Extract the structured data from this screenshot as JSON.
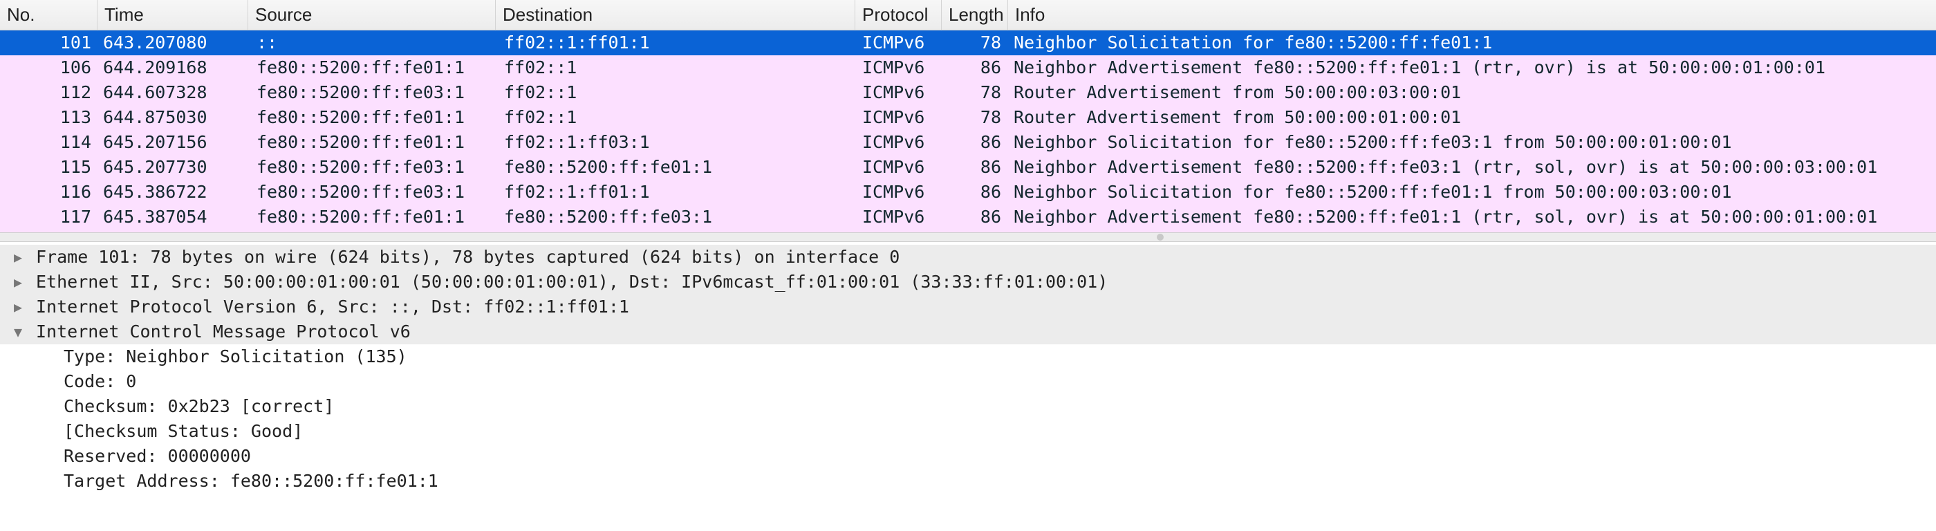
{
  "columns": [
    {
      "key": "no",
      "label": "No."
    },
    {
      "key": "time",
      "label": "Time"
    },
    {
      "key": "source",
      "label": "Source"
    },
    {
      "key": "destination",
      "label": "Destination"
    },
    {
      "key": "protocol",
      "label": "Protocol"
    },
    {
      "key": "length",
      "label": "Length"
    },
    {
      "key": "info",
      "label": "Info"
    }
  ],
  "packets": [
    {
      "no": "101",
      "time": "643.207080",
      "source": "::",
      "destination": "ff02::1:ff01:1",
      "protocol": "ICMPv6",
      "length": "78",
      "info": "Neighbor Solicitation for fe80::5200:ff:fe01:1"
    },
    {
      "no": "106",
      "time": "644.209168",
      "source": "fe80::5200:ff:fe01:1",
      "destination": "ff02::1",
      "protocol": "ICMPv6",
      "length": "86",
      "info": "Neighbor Advertisement fe80::5200:ff:fe01:1 (rtr, ovr) is at 50:00:00:01:00:01"
    },
    {
      "no": "112",
      "time": "644.607328",
      "source": "fe80::5200:ff:fe03:1",
      "destination": "ff02::1",
      "protocol": "ICMPv6",
      "length": "78",
      "info": "Router Advertisement from 50:00:00:03:00:01"
    },
    {
      "no": "113",
      "time": "644.875030",
      "source": "fe80::5200:ff:fe01:1",
      "destination": "ff02::1",
      "protocol": "ICMPv6",
      "length": "78",
      "info": "Router Advertisement from 50:00:00:01:00:01"
    },
    {
      "no": "114",
      "time": "645.207156",
      "source": "fe80::5200:ff:fe01:1",
      "destination": "ff02::1:ff03:1",
      "protocol": "ICMPv6",
      "length": "86",
      "info": "Neighbor Solicitation for fe80::5200:ff:fe03:1 from 50:00:00:01:00:01"
    },
    {
      "no": "115",
      "time": "645.207730",
      "source": "fe80::5200:ff:fe03:1",
      "destination": "fe80::5200:ff:fe01:1",
      "protocol": "ICMPv6",
      "length": "86",
      "info": "Neighbor Advertisement fe80::5200:ff:fe03:1 (rtr, sol, ovr) is at 50:00:00:03:00:01"
    },
    {
      "no": "116",
      "time": "645.386722",
      "source": "fe80::5200:ff:fe03:1",
      "destination": "ff02::1:ff01:1",
      "protocol": "ICMPv6",
      "length": "86",
      "info": "Neighbor Solicitation for fe80::5200:ff:fe01:1 from 50:00:00:03:00:01"
    },
    {
      "no": "117",
      "time": "645.387054",
      "source": "fe80::5200:ff:fe01:1",
      "destination": "fe80::5200:ff:fe03:1",
      "protocol": "ICMPv6",
      "length": "86",
      "info": "Neighbor Advertisement fe80::5200:ff:fe01:1 (rtr, sol, ovr) is at 50:00:00:01:00:01"
    }
  ],
  "selected_packet": "101",
  "details": {
    "frame": "Frame 101: 78 bytes on wire (624 bits), 78 bytes captured (624 bits) on interface 0",
    "ethernet": "Ethernet II, Src: 50:00:00:01:00:01 (50:00:00:01:00:01), Dst: IPv6mcast_ff:01:00:01 (33:33:ff:01:00:01)",
    "ipv6": "Internet Protocol Version 6, Src: ::, Dst: ff02::1:ff01:1",
    "icmpv6": "Internet Control Message Protocol v6",
    "icmpv6_fields": [
      "Type: Neighbor Solicitation (135)",
      "Code: 0",
      "Checksum: 0x2b23 [correct]",
      "[Checksum Status: Good]",
      "Reserved: 00000000",
      "Target Address: fe80::5200:ff:fe01:1"
    ]
  },
  "icons": {
    "collapsed": "triangle-right-icon",
    "expanded": "triangle-down-icon"
  },
  "colors": {
    "selection": "#0a63d6",
    "icmp_row": "#fce0ff"
  }
}
